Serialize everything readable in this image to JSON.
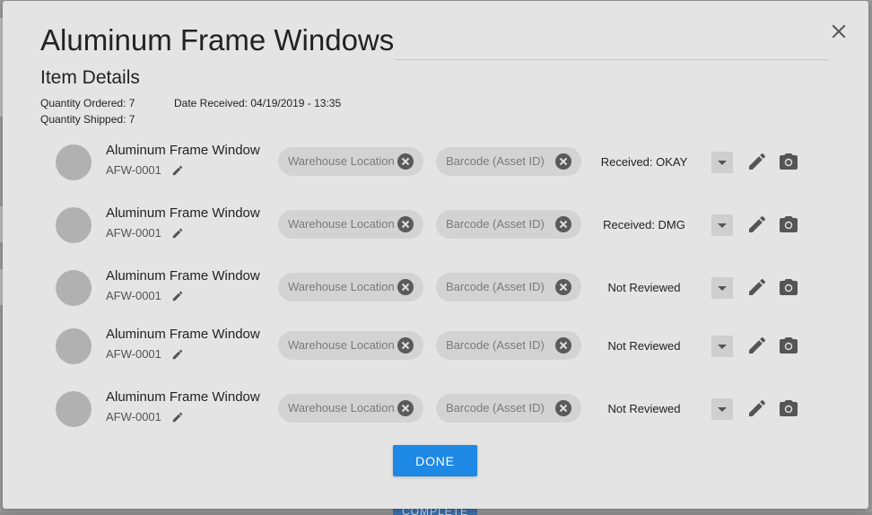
{
  "dialog": {
    "title": "Aluminum Frame Windows",
    "subtitle": "Item Details",
    "quantity_ordered": "Quantity Ordered: 7",
    "quantity_shipped": "Quantity Shipped: 7",
    "date_received": "Date Received: 04/19/2019 - 13:35",
    "close_icon": "close-icon",
    "done_label": "DONE"
  },
  "background": {
    "complete_label": "COMPLETE"
  },
  "items": [
    {
      "name": "Aluminum Frame Window",
      "sku": "AFW-0001",
      "warehouse_placeholder": "Warehouse Location",
      "barcode_placeholder": "Barcode (Asset ID)",
      "status": "Received: OKAY"
    },
    {
      "name": "Aluminum Frame Window",
      "sku": "AFW-0001",
      "warehouse_placeholder": "Warehouse Location",
      "barcode_placeholder": "Barcode (Asset ID)",
      "status": "Received: DMG"
    },
    {
      "name": "Aluminum Frame Window",
      "sku": "AFW-0001",
      "warehouse_placeholder": "Warehouse Location",
      "barcode_placeholder": "Barcode (Asset ID)",
      "status": "Not Reviewed"
    },
    {
      "name": "Aluminum Frame Window",
      "sku": "AFW-0001",
      "warehouse_placeholder": "Warehouse Location",
      "barcode_placeholder": "Barcode (Asset ID)",
      "status": "Not Reviewed"
    },
    {
      "name": "Aluminum Frame Window",
      "sku": "AFW-0001",
      "warehouse_placeholder": "Warehouse Location",
      "barcode_placeholder": "Barcode (Asset ID)",
      "status": "Not Reviewed"
    }
  ],
  "colors": {
    "primary": "#1e88e5",
    "chip_bg": "#d3d3d3",
    "icon": "#555555"
  },
  "icons": {
    "sku_edit": "pencil-icon",
    "chip_clear": "clear-circle-icon",
    "dropdown": "caret-down-icon",
    "edit": "pencil-icon",
    "camera": "camera-icon"
  }
}
